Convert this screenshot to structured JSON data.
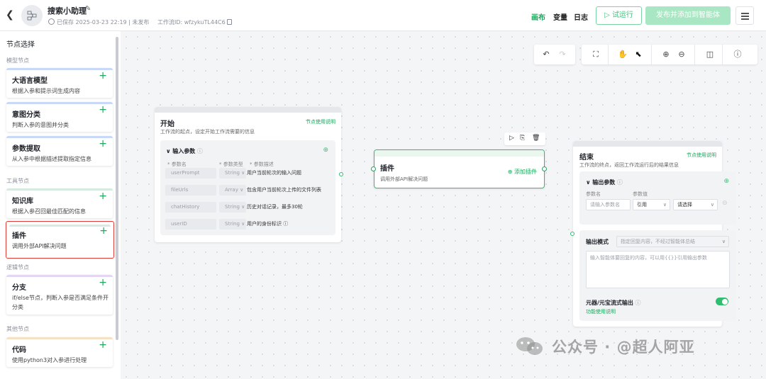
{
  "header": {
    "title": "搜索小助理",
    "saved_status": "已保存 2025-03-23 22:19 | 未发布",
    "workflow_id": "工作流ID: wfzykuTL44C6",
    "nav": {
      "canvas": "画布",
      "variables": "变量",
      "logs": "日志"
    },
    "run_label": "试运行",
    "publish_label": "发布并添加到智能体"
  },
  "sidebar": {
    "title": "节点选择",
    "sections": {
      "model": "模型节点",
      "tool": "工具节点",
      "logic": "逻辑节点",
      "other": "其他节点"
    },
    "cards": [
      {
        "name": "大语言模型",
        "desc": "根据入参和提示词生成内容",
        "color": "#c9d8f7"
      },
      {
        "name": "意图分类",
        "desc": "判断入参的意图并分类",
        "color": "#c9d8f7"
      },
      {
        "name": "参数提取",
        "desc": "从入参中根据描述提取指定信息",
        "color": "#c9d8f7"
      },
      {
        "name": "知识库",
        "desc": "根据入参召回最佳匹配的信息",
        "color": "#d6eadf"
      },
      {
        "name": "插件",
        "desc": "调用外部API解决问题",
        "color": "#d6eadf"
      },
      {
        "name": "分支",
        "desc": "if/else节点，判断入参是否满足条件开分类",
        "color": "#e2d6f2"
      },
      {
        "name": "代码",
        "desc": "使用python3对入参进行处理",
        "color": "#f5e1c4"
      }
    ]
  },
  "start_node": {
    "title": "开始",
    "desc": "工作流的起点，设定开始工作流需要的信息",
    "help": "节点使用说明",
    "input_label": "输入参数",
    "col_name": "* 参数名",
    "col_type": "* 参数类型",
    "col_desc": "* 参数描述",
    "params": [
      {
        "name": "userPrompt",
        "type": "String",
        "desc": "用户当前轮次的输入问题"
      },
      {
        "name": "fileUrls",
        "type": "Array",
        "desc": "包含用户当前轮次上传的文件列表"
      },
      {
        "name": "chatHistory",
        "type": "String",
        "desc": "历史对话记录，最多30轮"
      },
      {
        "name": "userID",
        "type": "String",
        "desc": "用户的身份标识"
      }
    ]
  },
  "plugin_node": {
    "title": "插件",
    "desc": "调用外部API解决问题",
    "add_label": "添加插件"
  },
  "end_node": {
    "title": "结束",
    "desc": "工作流的终点，返回工作流运行后的结果信息",
    "help": "节点使用说明",
    "output_label": "输出参数",
    "col_name": "参数名",
    "col_value": "参数值",
    "name_placeholder": "请输入参数名",
    "ref_value": "引用",
    "select_placeholder": "请选择",
    "mode_label": "输出模式",
    "mode_placeholder": "指定回复内容，不经过智能体总结",
    "content_placeholder": "输入智能体要回复的内容，可以用{{}}引用输出参数",
    "stream_label": "元器/元宝流式输出",
    "stream_help": "功能使用说明"
  },
  "watermark": "公众号 · @超人阿亚"
}
